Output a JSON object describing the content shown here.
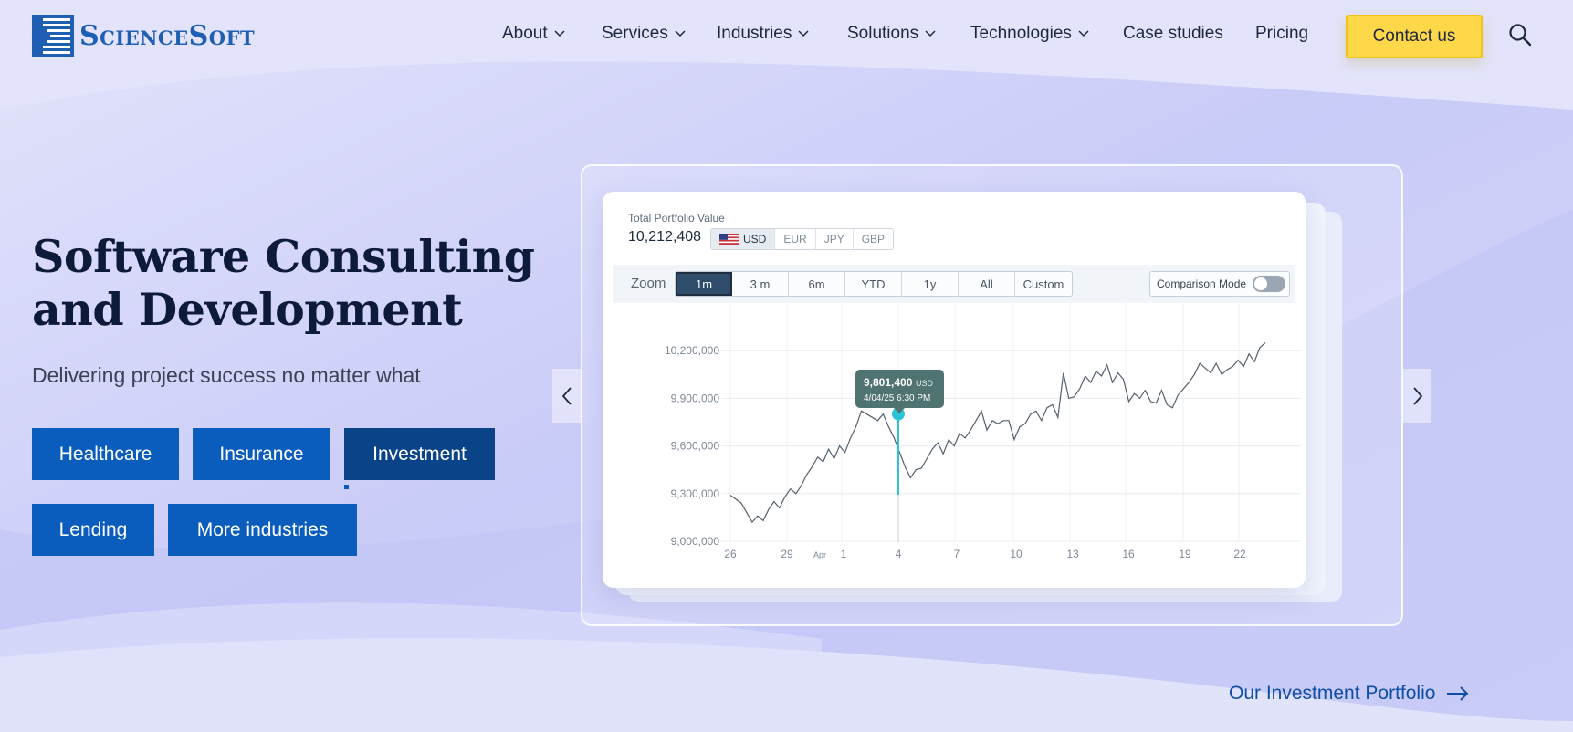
{
  "brand": {
    "name": "ScienceSoft"
  },
  "nav": {
    "items": [
      {
        "label": "About",
        "dropdown": true
      },
      {
        "label": "Services",
        "dropdown": true
      },
      {
        "label": "Industries",
        "dropdown": true
      },
      {
        "label": "Solutions",
        "dropdown": true
      },
      {
        "label": "Technologies",
        "dropdown": true
      },
      {
        "label": "Case studies",
        "dropdown": false
      },
      {
        "label": "Pricing",
        "dropdown": false
      }
    ],
    "contact_label": "Contact us",
    "search_icon": "search-icon"
  },
  "hero": {
    "title_line1": "Software Consulting",
    "title_line2": "and Development",
    "subtitle": "Delivering project success no matter what",
    "industries": [
      "Healthcare",
      "Insurance",
      "Investment",
      "Lending",
      "More industries"
    ],
    "active_industry": "Investment"
  },
  "widget": {
    "portfolio_label": "Total Portfolio Value",
    "portfolio_value": "10,212,408",
    "currencies": [
      "USD",
      "EUR",
      "JPY",
      "GBP"
    ],
    "selected_currency": "USD",
    "zoom_label": "Zoom",
    "zoom_options": [
      "1m",
      "3 m",
      "6m",
      "YTD",
      "1y",
      "All",
      "Custom"
    ],
    "selected_zoom": "1m",
    "comparison_label": "Comparison Mode",
    "comparison_on": false,
    "tooltip_value": "9,801,400",
    "tooltip_unit": "USD",
    "tooltip_date": "4/04/25  6:30 PM"
  },
  "chart_data": {
    "type": "line",
    "x_ticks": [
      "26",
      "29",
      "Apr",
      "1",
      "4",
      "7",
      "10",
      "13",
      "16",
      "19",
      "22"
    ],
    "y_ticks": [
      "9,000,000",
      "9,300,000",
      "9,600,000",
      "9,900,000",
      "10,200,000"
    ],
    "ylim": [
      9000000,
      10300000
    ],
    "series": [
      {
        "values": [
          9290000,
          9265000,
          9240000,
          9180000,
          9120000,
          9160000,
          9130000,
          9200000,
          9250000,
          9210000,
          9280000,
          9330000,
          9300000,
          9350000,
          9420000,
          9470000,
          9530000,
          9500000,
          9580000,
          9520000,
          9600000,
          9560000,
          9650000,
          9720000,
          9820000,
          9800000,
          9780000,
          9760000,
          9801400,
          9720000,
          9650000,
          9560000,
          9470000,
          9400000,
          9450000,
          9460000,
          9520000,
          9580000,
          9620000,
          9550000,
          9640000,
          9600000,
          9680000,
          9650000,
          9700000,
          9760000,
          9820000,
          9700000,
          9760000,
          9740000,
          9760000,
          9760000,
          9640000,
          9720000,
          9740000,
          9800000,
          9820000,
          9760000,
          9840000,
          9860000,
          9780000,
          10060000,
          9900000,
          9910000,
          9960000,
          10040000,
          10000000,
          10070000,
          10040000,
          10110000,
          10000000,
          10060000,
          10020000,
          9880000,
          9930000,
          9900000,
          9950000,
          9880000,
          9870000,
          9950000,
          9860000,
          9840000,
          9920000,
          9960000,
          10000000,
          10050000,
          10120000,
          10090000,
          10060000,
          10120000,
          10050000,
          10080000,
          10100000,
          10140000,
          10100000,
          10180000,
          10130000,
          10220000,
          10250000
        ]
      }
    ],
    "grid": true,
    "tooltip_point": {
      "x": "4",
      "y": 9801400
    },
    "line_color": "#55606c",
    "marker_color": "#2bc4d6"
  },
  "carousel": {
    "prev_icon": "chevron-left-icon",
    "next_icon": "chevron-right-icon"
  },
  "portfolio_link": {
    "label": "Our Investment Portfolio"
  },
  "colors": {
    "brand_blue": "#0a5dbd",
    "active_blue": "#0a4387",
    "contact_yellow": "#ffd84a",
    "link_blue": "#0e4fa6"
  }
}
